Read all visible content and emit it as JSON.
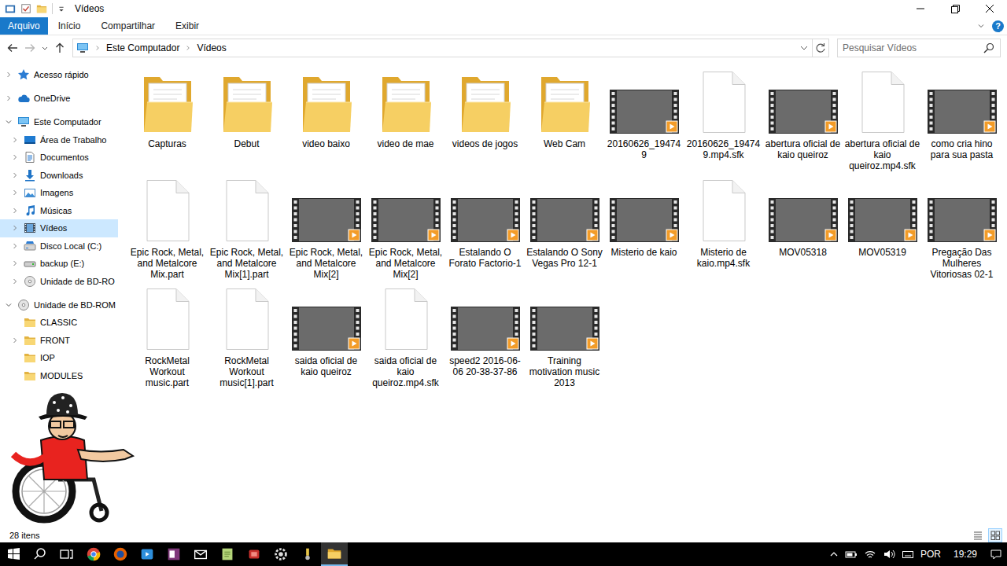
{
  "window": {
    "title": "Vídeos",
    "help": "?"
  },
  "ribbon": {
    "tabs": [
      {
        "label": "Arquivo",
        "kind": "file"
      },
      {
        "label": "Início",
        "kind": "tab"
      },
      {
        "label": "Compartilhar",
        "kind": "tab"
      },
      {
        "label": "Exibir",
        "kind": "tab"
      }
    ]
  },
  "address": {
    "crumbs": [
      "Este Computador",
      "Vídeos"
    ]
  },
  "search": {
    "placeholder": "Pesquisar Vídeos"
  },
  "sidebar": {
    "items": [
      {
        "label": "Acesso rápido",
        "level": 0,
        "kind": "star",
        "arrow": "collapsed",
        "selected": false
      },
      {
        "label": "OneDrive",
        "level": 0,
        "kind": "cloud",
        "arrow": "collapsed",
        "selected": false
      },
      {
        "label": "Este Computador",
        "level": 0,
        "kind": "computer",
        "arrow": "expanded",
        "selected": false
      },
      {
        "label": "Área de Trabalho",
        "level": 1,
        "kind": "desktop",
        "arrow": "collapsed",
        "selected": false
      },
      {
        "label": "Documentos",
        "level": 1,
        "kind": "documents",
        "arrow": "collapsed",
        "selected": false
      },
      {
        "label": "Downloads",
        "level": 1,
        "kind": "downloads",
        "arrow": "collapsed",
        "selected": false
      },
      {
        "label": "Imagens",
        "level": 1,
        "kind": "images",
        "arrow": "collapsed",
        "selected": false
      },
      {
        "label": "Músicas",
        "level": 1,
        "kind": "music",
        "arrow": "collapsed",
        "selected": false
      },
      {
        "label": "Vídeos",
        "level": 1,
        "kind": "videos",
        "arrow": "collapsed",
        "selected": true
      },
      {
        "label": "Disco Local (C:)",
        "level": 1,
        "kind": "drive",
        "arrow": "collapsed",
        "selected": false
      },
      {
        "label": "backup (E:)",
        "level": 1,
        "kind": "usb",
        "arrow": "collapsed",
        "selected": false
      },
      {
        "label": "Unidade de BD-RO",
        "level": 1,
        "kind": "disc",
        "arrow": "collapsed",
        "selected": false
      },
      {
        "label": "Unidade de BD-ROM",
        "level": 0,
        "kind": "disc",
        "arrow": "expanded",
        "selected": false
      },
      {
        "label": "CLASSIC",
        "level": 1,
        "kind": "folder",
        "arrow": "none",
        "selected": false
      },
      {
        "label": "FRONT",
        "level": 1,
        "kind": "folder",
        "arrow": "collapsed",
        "selected": false
      },
      {
        "label": "IOP",
        "level": 1,
        "kind": "folder",
        "arrow": "none",
        "selected": false
      },
      {
        "label": "MODULES",
        "level": 1,
        "kind": "folder",
        "arrow": "none",
        "selected": false
      }
    ]
  },
  "files": {
    "items": [
      {
        "label": "Capturas",
        "kind": "folder"
      },
      {
        "label": "Debut",
        "kind": "folder"
      },
      {
        "label": "video baixo",
        "kind": "folder"
      },
      {
        "label": "video de mae",
        "kind": "folder"
      },
      {
        "label": "videos de jogos",
        "kind": "folder"
      },
      {
        "label": "Web Cam",
        "kind": "folder"
      },
      {
        "label": "20160626_194749",
        "kind": "video"
      },
      {
        "label": "20160626_194749.mp4.sfk",
        "kind": "file"
      },
      {
        "label": "abertura oficial de kaio queiroz",
        "kind": "video"
      },
      {
        "label": "abertura oficial de kaio queiroz.mp4.sfk",
        "kind": "file"
      },
      {
        "label": "como cria hino para sua pasta",
        "kind": "video"
      },
      {
        "label": "Epic Rock, Metal, and Metalcore Mix.part",
        "kind": "file"
      },
      {
        "label": "Epic Rock, Metal, and Metalcore Mix[1].part",
        "kind": "file"
      },
      {
        "label": "Epic Rock, Metal, and Metalcore Mix[2]",
        "kind": "video"
      },
      {
        "label": "Epic Rock, Metal, and Metalcore Mix[2]",
        "kind": "video"
      },
      {
        "label": "Estalando O Forato Factorio-1",
        "kind": "video"
      },
      {
        "label": "Estalando O Sony Vegas Pro 12-1",
        "kind": "video"
      },
      {
        "label": "Misterio de kaio",
        "kind": "video"
      },
      {
        "label": "Misterio de kaio.mp4.sfk",
        "kind": "file"
      },
      {
        "label": "MOV05318",
        "kind": "video"
      },
      {
        "label": "MOV05319",
        "kind": "video"
      },
      {
        "label": "Pregação Das Mulheres Vitoriosas 02-1",
        "kind": "video"
      },
      {
        "label": "RockMetal Workout music.part",
        "kind": "file"
      },
      {
        "label": "RockMetal Workout music[1].part",
        "kind": "file"
      },
      {
        "label": "saida oficial de kaio queiroz",
        "kind": "video"
      },
      {
        "label": "saida oficial de kaio queiroz.mp4.sfk",
        "kind": "file"
      },
      {
        "label": "speed2 2016-06-06 20-38-37-86",
        "kind": "video"
      },
      {
        "label": "Training motivation music 2013",
        "kind": "video"
      }
    ]
  },
  "status_bar": {
    "count": "28 itens",
    "views": [
      {
        "kind": "details",
        "selected": false
      },
      {
        "kind": "icons",
        "selected": true
      }
    ]
  },
  "taskbar": {
    "apps": [
      {
        "kind": "chrome",
        "active": false
      },
      {
        "kind": "firefox",
        "active": false
      },
      {
        "kind": "media",
        "active": false
      },
      {
        "kind": "onenote",
        "active": false
      },
      {
        "kind": "mail",
        "active": false
      },
      {
        "kind": "notes",
        "active": false
      },
      {
        "kind": "red",
        "active": false
      },
      {
        "kind": "settings",
        "active": false
      },
      {
        "kind": "tool",
        "active": false
      },
      {
        "kind": "explorer",
        "active": true
      }
    ],
    "language": "POR",
    "time": "19:29"
  }
}
